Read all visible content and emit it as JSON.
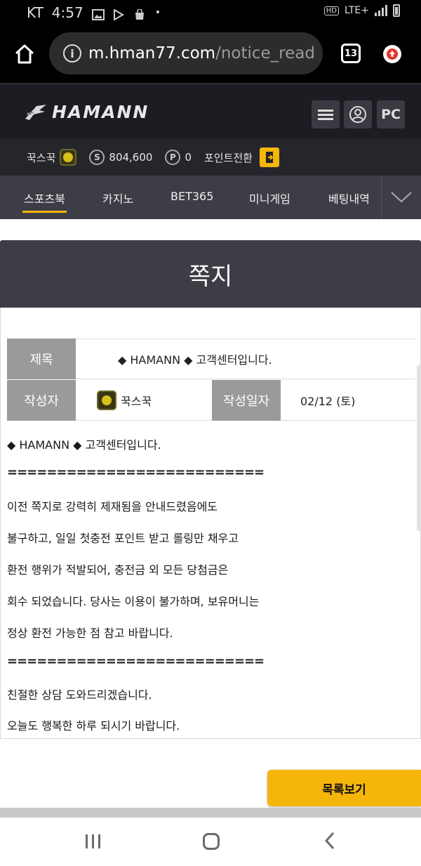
{
  "status_bar": {
    "carrier": "KT",
    "time": "4:57",
    "network": "LTE+"
  },
  "browser": {
    "url_domain": "m.hman77.com",
    "url_path": "/notice_read",
    "tab_count": "13"
  },
  "site": {
    "logo_text": "HAMANN",
    "pc_button": "PC"
  },
  "user": {
    "nickname": "꾹스꾹",
    "money": "804,600",
    "money_icon": "S",
    "points": "0",
    "points_icon": "P",
    "point_exchange_label": "포인트전환"
  },
  "nav": {
    "tabs": [
      "스포츠북",
      "카지노",
      "BET365",
      "미니게임",
      "베팅내역"
    ],
    "active_index": 0
  },
  "page": {
    "title": "쪽지"
  },
  "message": {
    "subject_label": "제목",
    "subject": "◆ HAMANN ◆ 고객센터입니다.",
    "author_label": "작성자",
    "author": "꾹스꾹",
    "date_label": "작성일자",
    "date": "02/12 (토)",
    "body": [
      "◆ HAMANN ◆ 고객센터입니다.",
      "==========================",
      "이전 쪽지로 강력히 제재됨을 안내드렸음에도",
      "불구하고, 일일 첫충전 포인트 받고 롤링만 채우고",
      "환전 행위가 적발되어, 충전금 외 모든 당첨금은",
      "회수 되었습니다. 당사는 이용이 불가하며, 보유머니는",
      "정상 환전 가능한 점 참고 바랍니다.",
      "==========================",
      "친절한 상담 도와드리겠습니다.",
      "오늘도 행복한 하루 되시기 바랍니다."
    ]
  },
  "actions": {
    "list_button": "목록보기"
  },
  "colors": {
    "accent": "#f5b50a",
    "header_bg": "#1c1d22",
    "nav_bg": "#3c3d45",
    "label_bg": "#9a9a9a"
  }
}
